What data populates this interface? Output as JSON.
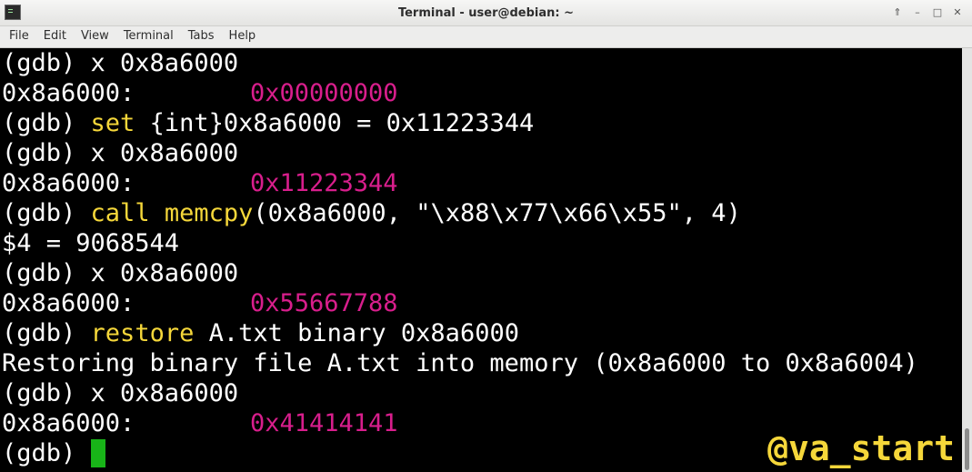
{
  "window": {
    "title": "Terminal - user@debian: ~",
    "buttons": [
      "⇑",
      "–",
      "□",
      "✕"
    ]
  },
  "menu": [
    "File",
    "Edit",
    "View",
    "Terminal",
    "Tabs",
    "Help"
  ],
  "terminal": {
    "l1": "(gdb) x 0x8a6000",
    "l2_addr": "0x8a6000:",
    "l2_val": "0x00000000",
    "l3_prompt": "(gdb) ",
    "l3_cmd": "set",
    "l3_rest": " {int}0x8a6000 = 0x11223344",
    "l4": "(gdb) x 0x8a6000",
    "l5_addr": "0x8a6000:",
    "l5_val": "0x11223344",
    "l6_prompt": "(gdb) ",
    "l6_cmd": "call",
    "l6_fn": "memcpy",
    "l6_rest": "(0x8a6000, \"\\x88\\x77\\x66\\x55\", 4)",
    "l7": "$4 = 9068544",
    "l8": "(gdb) x 0x8a6000",
    "l9_addr": "0x8a6000:",
    "l9_val": "0x55667788",
    "l10_prompt": "(gdb) ",
    "l10_cmd": "restore",
    "l10_rest": " A.txt binary 0x8a6000",
    "l11": "Restoring binary file A.txt into memory (0x8a6000 to 0x8a6004)",
    "l12": "(gdb) x 0x8a6000",
    "l13_addr": "0x8a6000:",
    "l13_val": "0x41414141",
    "l14_prompt": "(gdb) "
  },
  "watermark": "@va_start",
  "colors": {
    "background": "#000000",
    "text": "#ffffff",
    "command": "#f5d73a",
    "value": "#d81e8c",
    "cursor": "#18b418"
  }
}
